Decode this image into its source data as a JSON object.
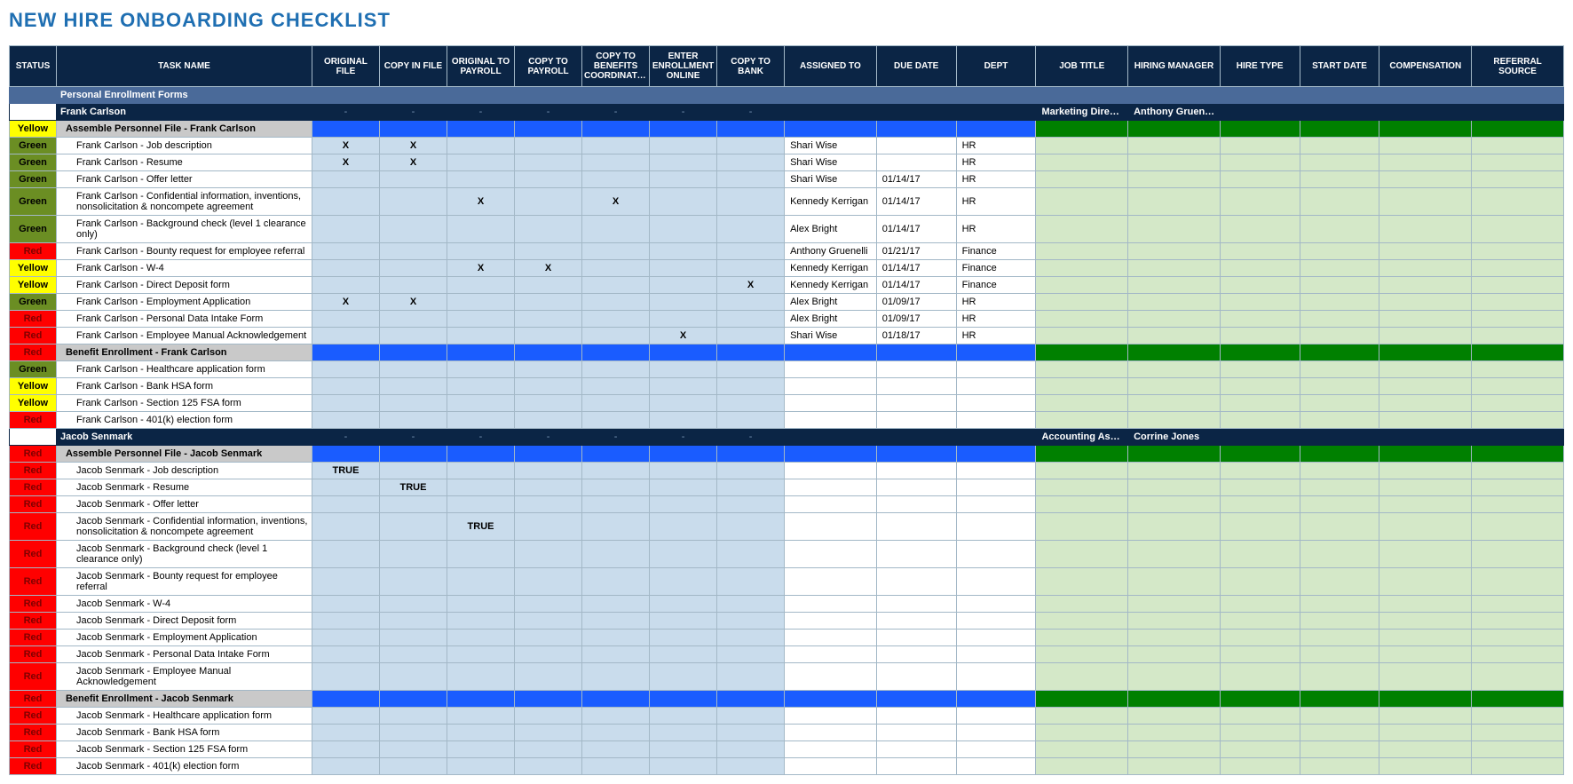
{
  "title": "NEW HIRE ONBOARDING CHECKLIST",
  "headers": [
    "STATUS",
    "TASK NAME",
    "ORIGINAL FILE",
    "COPY IN FILE",
    "ORIGINAL TO PAYROLL",
    "COPY TO PAYROLL",
    "COPY TO BENEFITS COORDINATOR",
    "ENTER ENROLLMENT ONLINE",
    "COPY TO BANK",
    "ASSIGNED TO",
    "DUE DATE",
    "DEPT",
    "JOB TITLE",
    "HIRING MANAGER",
    "HIRE TYPE",
    "START DATE",
    "COMPENSATION",
    "REFERRAL SOURCE"
  ],
  "rows": [
    {
      "t": "section",
      "label": "Personal Enrollment Forms"
    },
    {
      "t": "person",
      "name": "Frank Carlson",
      "job_title": "Marketing Director",
      "hiring_manager": "Anthony Gruenelli"
    },
    {
      "t": "group",
      "status": "Yellow",
      "label": "Assemble Personnel File - Frank Carlson"
    },
    {
      "t": "data",
      "status": "Green",
      "task": "Frank Carlson - Job description",
      "c": [
        "X",
        "X",
        "",
        "",
        "",
        "",
        ""
      ],
      "assigned": "Shari Wise",
      "due": "",
      "dept": "HR"
    },
    {
      "t": "data",
      "status": "Green",
      "task": "Frank Carlson - Resume",
      "c": [
        "X",
        "X",
        "",
        "",
        "",
        "",
        ""
      ],
      "assigned": "Shari Wise",
      "due": "",
      "dept": "HR"
    },
    {
      "t": "data",
      "status": "Green",
      "task": "Frank Carlson - Offer letter",
      "c": [
        "",
        "",
        "",
        "",
        "",
        "",
        ""
      ],
      "assigned": "Shari Wise",
      "due": "01/14/17",
      "dept": "HR"
    },
    {
      "t": "data",
      "status": "Green",
      "task": "Frank Carlson - Confidential information, inventions, nonsolicitation & noncompete agreement",
      "c": [
        "",
        "",
        "X",
        "",
        "X",
        "",
        ""
      ],
      "assigned": "Kennedy Kerrigan",
      "due": "01/14/17",
      "dept": "HR"
    },
    {
      "t": "data",
      "status": "Green",
      "task": "Frank Carlson - Background check (level 1 clearance only)",
      "c": [
        "",
        "",
        "",
        "",
        "",
        "",
        ""
      ],
      "assigned": "Alex Bright",
      "due": "01/14/17",
      "dept": "HR"
    },
    {
      "t": "data",
      "status": "Red",
      "task": "Frank Carlson - Bounty request for employee referral",
      "c": [
        "",
        "",
        "",
        "",
        "",
        "",
        ""
      ],
      "assigned": "Anthony Gruenelli",
      "due": "01/21/17",
      "dept": "Finance"
    },
    {
      "t": "data",
      "status": "Yellow",
      "task": "Frank Carlson - W-4",
      "c": [
        "",
        "",
        "X",
        "X",
        "",
        "",
        ""
      ],
      "assigned": "Kennedy Kerrigan",
      "due": "01/14/17",
      "dept": "Finance"
    },
    {
      "t": "data",
      "status": "Yellow",
      "task": "Frank Carlson - Direct Deposit form",
      "c": [
        "",
        "",
        "",
        "",
        "",
        "",
        "X"
      ],
      "assigned": "Kennedy Kerrigan",
      "due": "01/14/17",
      "dept": "Finance"
    },
    {
      "t": "data",
      "status": "Green",
      "task": "Frank Carlson - Employment Application",
      "c": [
        "X",
        "X",
        "",
        "",
        "",
        "",
        ""
      ],
      "assigned": "Alex Bright",
      "due": "01/09/17",
      "dept": "HR"
    },
    {
      "t": "data",
      "status": "Red",
      "task": "Frank Carlson - Personal Data Intake Form",
      "c": [
        "",
        "",
        "",
        "",
        "",
        "",
        ""
      ],
      "assigned": "Alex Bright",
      "due": "01/09/17",
      "dept": "HR"
    },
    {
      "t": "data",
      "status": "Red",
      "task": "Frank Carlson - Employee Manual Acknowledgement",
      "c": [
        "",
        "",
        "",
        "",
        "",
        "X",
        ""
      ],
      "assigned": "Shari Wise",
      "due": "01/18/17",
      "dept": "HR"
    },
    {
      "t": "group",
      "status": "Red",
      "label": "Benefit Enrollment - Frank Carlson"
    },
    {
      "t": "data",
      "status": "Green",
      "task": "Frank Carlson - Healthcare application form",
      "c": [
        "",
        "",
        "",
        "",
        "",
        "",
        ""
      ],
      "assigned": "",
      "due": "",
      "dept": ""
    },
    {
      "t": "data",
      "status": "Yellow",
      "task": "Frank Carlson - Bank HSA form",
      "c": [
        "",
        "",
        "",
        "",
        "",
        "",
        ""
      ],
      "assigned": "",
      "due": "",
      "dept": ""
    },
    {
      "t": "data",
      "status": "Yellow",
      "task": "Frank Carlson - Section 125 FSA form",
      "c": [
        "",
        "",
        "",
        "",
        "",
        "",
        ""
      ],
      "assigned": "",
      "due": "",
      "dept": ""
    },
    {
      "t": "data",
      "status": "Red",
      "task": "Frank Carlson - 401(k) election form",
      "c": [
        "",
        "",
        "",
        "",
        "",
        "",
        ""
      ],
      "assigned": "",
      "due": "",
      "dept": ""
    },
    {
      "t": "person",
      "name": "Jacob Senmark",
      "job_title": "Accounting Associate",
      "hiring_manager": "Corrine Jones"
    },
    {
      "t": "group",
      "status": "Red",
      "label": "Assemble Personnel File - Jacob Senmark"
    },
    {
      "t": "data",
      "status": "Red",
      "task": "Jacob Senmark - Job description",
      "c": [
        "TRUE",
        "",
        "",
        "",
        "",
        "",
        ""
      ],
      "assigned": "",
      "due": "",
      "dept": ""
    },
    {
      "t": "data",
      "status": "Red",
      "task": "Jacob Senmark - Resume",
      "c": [
        "",
        "TRUE",
        "",
        "",
        "",
        "",
        ""
      ],
      "assigned": "",
      "due": "",
      "dept": ""
    },
    {
      "t": "data",
      "status": "Red",
      "task": "Jacob Senmark - Offer letter",
      "c": [
        "",
        "",
        "",
        "",
        "",
        "",
        ""
      ],
      "assigned": "",
      "due": "",
      "dept": ""
    },
    {
      "t": "data",
      "status": "Red",
      "task": "Jacob Senmark - Confidential information, inventions, nonsolicitation & noncompete agreement",
      "c": [
        "",
        "",
        "TRUE",
        "",
        "",
        "",
        ""
      ],
      "assigned": "",
      "due": "",
      "dept": ""
    },
    {
      "t": "data",
      "status": "Red",
      "task": "Jacob Senmark - Background check (level 1 clearance only)",
      "c": [
        "",
        "",
        "",
        "",
        "",
        "",
        ""
      ],
      "assigned": "",
      "due": "",
      "dept": ""
    },
    {
      "t": "data",
      "status": "Red",
      "task": "Jacob Senmark - Bounty request for employee referral",
      "c": [
        "",
        "",
        "",
        "",
        "",
        "",
        ""
      ],
      "assigned": "",
      "due": "",
      "dept": ""
    },
    {
      "t": "data",
      "status": "Red",
      "task": "Jacob Senmark - W-4",
      "c": [
        "",
        "",
        "",
        "",
        "",
        "",
        ""
      ],
      "assigned": "",
      "due": "",
      "dept": ""
    },
    {
      "t": "data",
      "status": "Red",
      "task": "Jacob Senmark - Direct Deposit form",
      "c": [
        "",
        "",
        "",
        "",
        "",
        "",
        ""
      ],
      "assigned": "",
      "due": "",
      "dept": ""
    },
    {
      "t": "data",
      "status": "Red",
      "task": "Jacob Senmark - Employment Application",
      "c": [
        "",
        "",
        "",
        "",
        "",
        "",
        ""
      ],
      "assigned": "",
      "due": "",
      "dept": ""
    },
    {
      "t": "data",
      "status": "Red",
      "task": "Jacob Senmark - Personal Data Intake Form",
      "c": [
        "",
        "",
        "",
        "",
        "",
        "",
        ""
      ],
      "assigned": "",
      "due": "",
      "dept": ""
    },
    {
      "t": "data",
      "status": "Red",
      "task": "Jacob Senmark - Employee Manual Acknowledgement",
      "c": [
        "",
        "",
        "",
        "",
        "",
        "",
        ""
      ],
      "assigned": "",
      "due": "",
      "dept": ""
    },
    {
      "t": "group",
      "status": "Red",
      "label": "Benefit Enrollment - Jacob Senmark"
    },
    {
      "t": "data",
      "status": "Red",
      "task": "Jacob Senmark - Healthcare application form",
      "c": [
        "",
        "",
        "",
        "",
        "",
        "",
        ""
      ],
      "assigned": "",
      "due": "",
      "dept": ""
    },
    {
      "t": "data",
      "status": "Red",
      "task": "Jacob Senmark - Bank HSA form",
      "c": [
        "",
        "",
        "",
        "",
        "",
        "",
        ""
      ],
      "assigned": "",
      "due": "",
      "dept": ""
    },
    {
      "t": "data",
      "status": "Red",
      "task": "Jacob Senmark - Section 125 FSA form",
      "c": [
        "",
        "",
        "",
        "",
        "",
        "",
        ""
      ],
      "assigned": "",
      "due": "",
      "dept": ""
    },
    {
      "t": "data",
      "status": "Red",
      "task": "Jacob Senmark - 401(k) election form",
      "c": [
        "",
        "",
        "",
        "",
        "",
        "",
        ""
      ],
      "assigned": "",
      "due": "",
      "dept": ""
    }
  ]
}
